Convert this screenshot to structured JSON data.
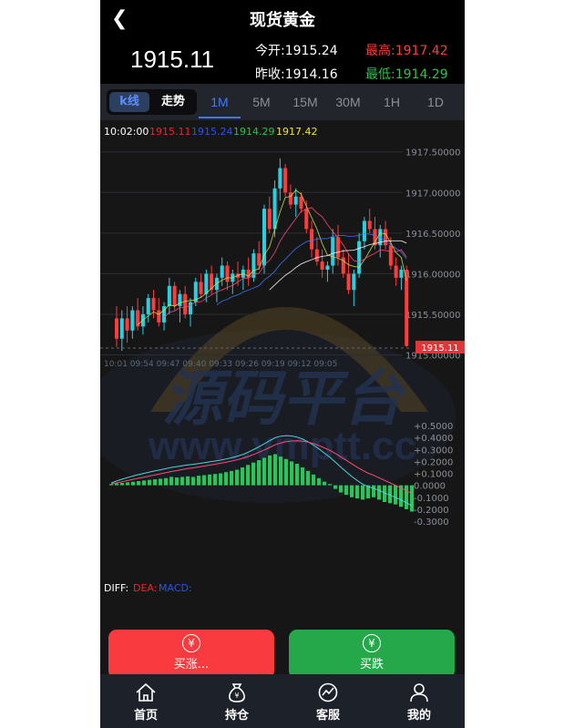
{
  "header": {
    "title": "现货黄金",
    "price": "1915.11",
    "open_label": "今开:",
    "open_value": "1915.24",
    "high_label": "最高:",
    "high_value": "1917.42",
    "prev_close_label": "昨收:",
    "prev_close_value": "1914.16",
    "low_label": "最低:",
    "low_value": "1914.29"
  },
  "tabs": {
    "kline": "k线",
    "trend": "走势",
    "timeframes": [
      "1M",
      "5M",
      "15M",
      "30M",
      "1H",
      "1D"
    ],
    "active_index": 0
  },
  "chart_info": {
    "time": "10:02:00",
    "v1": "1915.11",
    "v2": "1915.24",
    "v3": "1914.29",
    "v4": "1917.42"
  },
  "watermark": {
    "line1": "源码平台",
    "line2": "www.ymptt.cc"
  },
  "chart_data": [
    {
      "type": "candlestick",
      "y_ticks": [
        "1917.50000",
        "1917.00000",
        "1916.50000",
        "1916.00000",
        "1915.50000",
        "1915.00000"
      ],
      "ylim": [
        1914.95,
        1917.62
      ],
      "last_price_tag": "1915.11",
      "x_labels": "10:01 09:54 09:47 09:40 09:33 09:26 09:19 09:12 09:05",
      "candles": [
        {
          "o": 1915.45,
          "h": 1915.6,
          "l": 1915.1,
          "c": 1915.2
        },
        {
          "o": 1915.2,
          "h": 1915.55,
          "l": 1915.05,
          "c": 1915.45
        },
        {
          "o": 1915.45,
          "h": 1915.6,
          "l": 1915.15,
          "c": 1915.3
        },
        {
          "o": 1915.3,
          "h": 1915.6,
          "l": 1915.2,
          "c": 1915.55
        },
        {
          "o": 1915.55,
          "h": 1915.7,
          "l": 1915.3,
          "c": 1915.35
        },
        {
          "o": 1915.35,
          "h": 1915.6,
          "l": 1915.25,
          "c": 1915.5
        },
        {
          "o": 1915.5,
          "h": 1915.75,
          "l": 1915.4,
          "c": 1915.7
        },
        {
          "o": 1915.7,
          "h": 1915.8,
          "l": 1915.45,
          "c": 1915.55
        },
        {
          "o": 1915.55,
          "h": 1915.7,
          "l": 1915.35,
          "c": 1915.4
        },
        {
          "o": 1915.4,
          "h": 1915.65,
          "l": 1915.3,
          "c": 1915.6
        },
        {
          "o": 1915.6,
          "h": 1915.95,
          "l": 1915.5,
          "c": 1915.85
        },
        {
          "o": 1915.85,
          "h": 1915.9,
          "l": 1915.55,
          "c": 1915.6
        },
        {
          "o": 1915.6,
          "h": 1915.8,
          "l": 1915.4,
          "c": 1915.75
        },
        {
          "o": 1915.75,
          "h": 1915.85,
          "l": 1915.45,
          "c": 1915.5
        },
        {
          "o": 1915.5,
          "h": 1915.7,
          "l": 1915.35,
          "c": 1915.65
        },
        {
          "o": 1915.65,
          "h": 1915.95,
          "l": 1915.6,
          "c": 1915.9
        },
        {
          "o": 1915.9,
          "h": 1916.0,
          "l": 1915.7,
          "c": 1915.75
        },
        {
          "o": 1915.75,
          "h": 1916.05,
          "l": 1915.65,
          "c": 1916.0
        },
        {
          "o": 1916.0,
          "h": 1916.1,
          "l": 1915.75,
          "c": 1915.8
        },
        {
          "o": 1915.8,
          "h": 1916.0,
          "l": 1915.65,
          "c": 1915.95
        },
        {
          "o": 1915.95,
          "h": 1916.2,
          "l": 1915.85,
          "c": 1916.1
        },
        {
          "o": 1916.1,
          "h": 1916.15,
          "l": 1915.8,
          "c": 1915.9
        },
        {
          "o": 1915.9,
          "h": 1916.05,
          "l": 1915.75,
          "c": 1916.0
        },
        {
          "o": 1916.0,
          "h": 1916.15,
          "l": 1915.85,
          "c": 1915.95
        },
        {
          "o": 1915.95,
          "h": 1916.1,
          "l": 1915.8,
          "c": 1916.05
        },
        {
          "o": 1916.05,
          "h": 1916.2,
          "l": 1915.85,
          "c": 1915.95
        },
        {
          "o": 1915.95,
          "h": 1916.3,
          "l": 1915.9,
          "c": 1916.25
        },
        {
          "o": 1916.25,
          "h": 1916.4,
          "l": 1916.05,
          "c": 1916.1
        },
        {
          "o": 1916.1,
          "h": 1916.85,
          "l": 1916.0,
          "c": 1916.8
        },
        {
          "o": 1916.8,
          "h": 1916.95,
          "l": 1916.5,
          "c": 1916.55
        },
        {
          "o": 1916.55,
          "h": 1917.15,
          "l": 1916.45,
          "c": 1917.05
        },
        {
          "o": 1917.05,
          "h": 1917.42,
          "l": 1916.9,
          "c": 1917.3
        },
        {
          "o": 1917.3,
          "h": 1917.35,
          "l": 1916.95,
          "c": 1917.0
        },
        {
          "o": 1917.0,
          "h": 1917.1,
          "l": 1916.8,
          "c": 1916.85
        },
        {
          "o": 1916.85,
          "h": 1917.05,
          "l": 1916.7,
          "c": 1916.95
        },
        {
          "o": 1916.95,
          "h": 1917.0,
          "l": 1916.75,
          "c": 1916.8
        },
        {
          "o": 1916.8,
          "h": 1916.9,
          "l": 1916.5,
          "c": 1916.55
        },
        {
          "o": 1916.55,
          "h": 1916.65,
          "l": 1916.2,
          "c": 1916.3
        },
        {
          "o": 1916.3,
          "h": 1916.45,
          "l": 1916.1,
          "c": 1916.15
        },
        {
          "o": 1916.15,
          "h": 1916.3,
          "l": 1915.95,
          "c": 1916.05
        },
        {
          "o": 1916.05,
          "h": 1916.15,
          "l": 1915.9,
          "c": 1916.1
        },
        {
          "o": 1916.1,
          "h": 1916.55,
          "l": 1916.0,
          "c": 1916.45
        },
        {
          "o": 1916.45,
          "h": 1916.6,
          "l": 1916.1,
          "c": 1916.2
        },
        {
          "o": 1916.2,
          "h": 1916.3,
          "l": 1915.95,
          "c": 1916.0
        },
        {
          "o": 1916.0,
          "h": 1916.25,
          "l": 1915.75,
          "c": 1915.8
        },
        {
          "o": 1915.8,
          "h": 1916.05,
          "l": 1915.6,
          "c": 1916.0
        },
        {
          "o": 1916.0,
          "h": 1916.5,
          "l": 1915.95,
          "c": 1916.4
        },
        {
          "o": 1916.4,
          "h": 1916.7,
          "l": 1916.3,
          "c": 1916.65
        },
        {
          "o": 1916.65,
          "h": 1916.8,
          "l": 1916.5,
          "c": 1916.55
        },
        {
          "o": 1916.55,
          "h": 1916.7,
          "l": 1916.3,
          "c": 1916.35
        },
        {
          "o": 1916.35,
          "h": 1916.6,
          "l": 1916.2,
          "c": 1916.55
        },
        {
          "o": 1916.55,
          "h": 1916.65,
          "l": 1916.3,
          "c": 1916.35
        },
        {
          "o": 1916.35,
          "h": 1916.45,
          "l": 1916.05,
          "c": 1916.1
        },
        {
          "o": 1916.1,
          "h": 1916.2,
          "l": 1915.85,
          "c": 1915.95
        },
        {
          "o": 1915.95,
          "h": 1916.1,
          "l": 1915.8,
          "c": 1916.05
        },
        {
          "o": 1916.05,
          "h": 1916.1,
          "l": 1915.1,
          "c": 1915.11
        }
      ]
    },
    {
      "type": "bar",
      "name": "MACD",
      "y_ticks": [
        "+0.5000",
        "+0.4000",
        "+0.3000",
        "+0.2000",
        "+0.1000",
        "0.0000",
        "-0.1000",
        "-0.2000",
        "-0.3000"
      ],
      "ylim": [
        -0.3,
        0.5
      ],
      "legend": {
        "diff": "DIFF:",
        "dea": "DEA:",
        "macd": "MACD:"
      },
      "values": [
        0.01,
        0.015,
        0.02,
        0.025,
        0.03,
        0.035,
        0.04,
        0.045,
        0.05,
        0.055,
        0.06,
        0.07,
        0.065,
        0.07,
        0.075,
        0.07,
        0.08,
        0.085,
        0.09,
        0.095,
        0.1,
        0.11,
        0.12,
        0.13,
        0.15,
        0.17,
        0.19,
        0.21,
        0.23,
        0.25,
        0.26,
        0.24,
        0.22,
        0.2,
        0.18,
        0.15,
        0.12,
        0.09,
        0.06,
        0.03,
        0.01,
        -0.03,
        -0.06,
        -0.08,
        -0.1,
        -0.11,
        -0.12,
        -0.11,
        -0.1,
        -0.12,
        -0.14,
        -0.15,
        -0.16,
        -0.18,
        -0.2,
        -0.22
      ]
    }
  ],
  "buttons": {
    "buy_up": "买涨...",
    "buy_down": "买跌",
    "currency_symbol": "¥"
  },
  "tabbar": [
    {
      "label": "首页",
      "icon": "home-icon"
    },
    {
      "label": "持仓",
      "icon": "money-bag-icon"
    },
    {
      "label": "客服",
      "icon": "chart-circle-icon"
    },
    {
      "label": "我的",
      "icon": "user-icon"
    }
  ],
  "colors": {
    "up": "#ff3b3b",
    "down": "#26d0e0",
    "buy_up_bg": "#f93a3e",
    "buy_down_bg": "#24a84a",
    "accent": "#3a7bff"
  }
}
